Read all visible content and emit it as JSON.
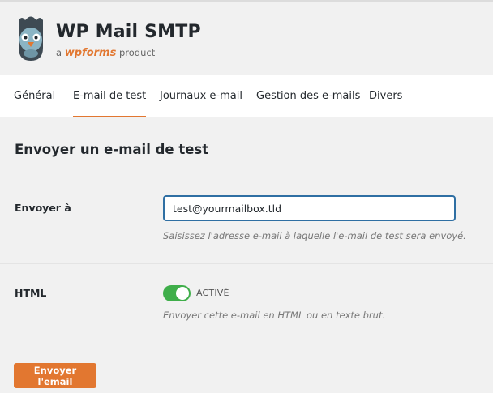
{
  "header": {
    "title": "WP Mail SMTP",
    "subtitle_prefix": "a",
    "subtitle_brand": "wpforms",
    "subtitle_suffix": "product",
    "logo_icon": "pigeon-logo-icon"
  },
  "tabs": [
    {
      "label": "Général",
      "active": false
    },
    {
      "label": "E-mail de test",
      "active": true
    },
    {
      "label": "Journaux e-mail",
      "active": false
    },
    {
      "label": "Gestion des e-mails",
      "active": false
    },
    {
      "label": "Divers",
      "active": false
    }
  ],
  "section": {
    "title": "Envoyer un e-mail de test",
    "send_to": {
      "label": "Envoyer à",
      "value": "test@yourmailbox.tld",
      "hint": "Saisissez l'adresse e-mail à laquelle l'e-mail de test sera envoyé."
    },
    "html": {
      "label": "HTML",
      "toggle_on": true,
      "toggle_label": "ACTIVÉ",
      "hint": "Envoyer cette e-mail en HTML ou en texte brut."
    },
    "send_button": "Envoyer l'email"
  },
  "colors": {
    "accent": "#e27730",
    "toggle_on": "#3fae4a",
    "input_focus": "#2f6fa3"
  }
}
